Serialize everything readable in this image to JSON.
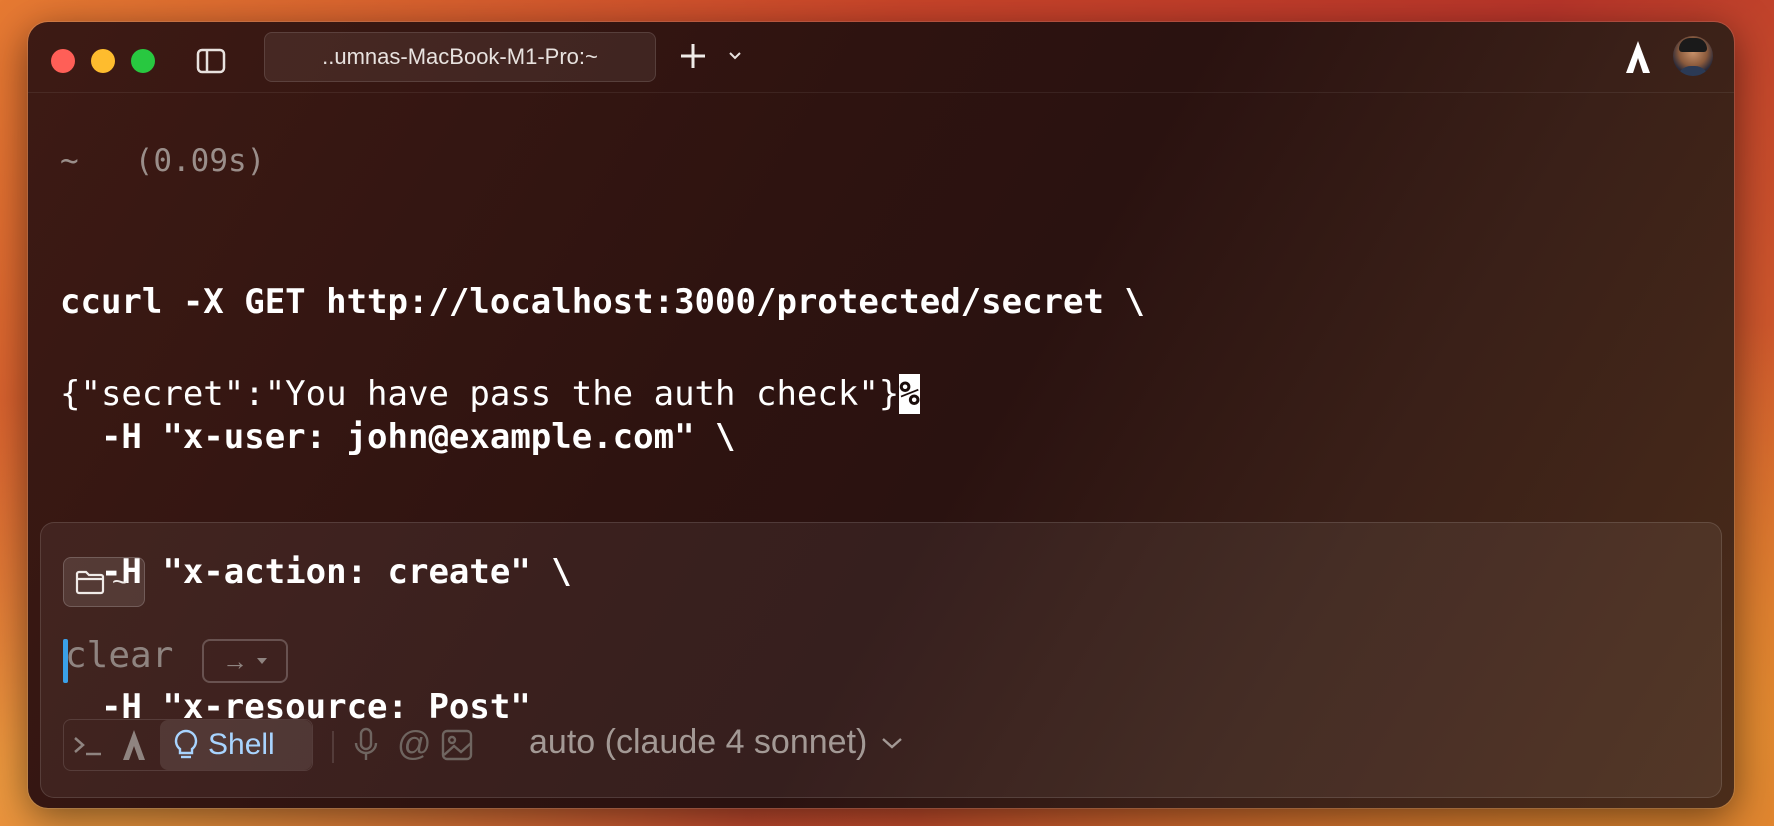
{
  "window": {
    "tab_title": "..umnas-MacBook-M1-Pro:~"
  },
  "terminal": {
    "prompt_dir": "~",
    "prompt_time": "(0.09s)",
    "command_lines": [
      "ccurl -X GET http://localhost:3000/protected/secret \\",
      "  -H \"x-user: john@example.com\" \\",
      "  -H \"x-action: create\" \\",
      "  -H \"x-resource: Post\""
    ],
    "output": "{\"secret\":\"You have pass the auth check\"}",
    "output_end_marker": "%"
  },
  "input": {
    "directory": "~",
    "placeholder_text": "clear",
    "hint_key": "→",
    "mode_label": "Shell",
    "at_symbol": "@",
    "model_label": "auto (claude 4 sonnet)"
  },
  "colors": {
    "accent_blue": "#3aa0e8",
    "shell_label": "#a8d4ff"
  }
}
